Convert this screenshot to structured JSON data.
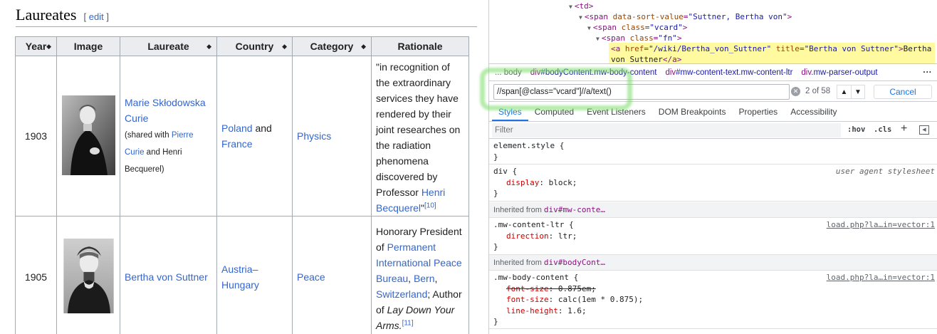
{
  "wiki": {
    "heading": "Laureates",
    "edit_link": "edit",
    "table": {
      "headers": [
        "Year",
        "Image",
        "Laureate",
        "Country",
        "Category",
        "Rationale"
      ],
      "sort_icon": "◆",
      "rows": [
        {
          "year": "1903",
          "laureate": "Marie Skłodowska Curie",
          "shared_prefix": "(shared with ",
          "shared_link1": "Pierre Curie",
          "shared_and": " and ",
          "shared_link2": "Henri Becquerel",
          "shared_suffix": ")",
          "country_a": "Poland",
          "country_and": " and ",
          "country_b": "France",
          "category": "Physics",
          "rationale_text": "\"in recognition of the extraordinary services they have rendered by their joint researches on the radiation phenomena discovered by Professor ",
          "rationale_link": "Henri Becquerel",
          "rationale_end": "\"",
          "ref": "[10]"
        },
        {
          "year": "1905",
          "laureate": "Bertha von Suttner",
          "country": "Austria–Hungary",
          "category": "Peace",
          "rationale_1": "Honorary President of ",
          "rationale_link1": "Permanent International Peace Bureau",
          "rationale_comma1": ", ",
          "rationale_link2": "Bern",
          "rationale_comma2": ", ",
          "rationale_link3": "Switzerland",
          "rationale_2": "; Author of ",
          "rationale_book": "Lay Down Your Arms.",
          "ref": "[11]"
        }
      ]
    }
  },
  "devtools": {
    "dom": {
      "line1_tag": "<td>",
      "line2_open": "<span ",
      "line2_attr": "data-sort-value",
      "line2_val": "\"Suttner, Bertha von\"",
      "line2_close": ">",
      "line3_open": "<span ",
      "line3_attr": "class",
      "line3_val": "\"vcard\"",
      "line3_close": ">",
      "line4_open": "<span ",
      "line4_attr": "class",
      "line4_val": "\"fn\"",
      "line4_close": ">",
      "line5_open": "<a ",
      "line5_attr1": "href",
      "line5_val1": "\"/wiki/Bertha_von_Suttner\"",
      "line5_attr2": "title",
      "line5_val2": "\"Bertha von Suttner\"",
      "line5_text": "Bertha",
      "line6_text": "von Suttner",
      "line6_close": "</a>"
    },
    "breadcrumbs": [
      {
        "tag": "... ",
        "cls": "",
        "extra": "body",
        "dim": true
      },
      {
        "tag": "div",
        "cls": "#bodyContent",
        "extra": ".mw-body-content"
      },
      {
        "tag": "div",
        "cls": "#mw-content-text",
        "extra": ".mw-content-ltr"
      },
      {
        "tag": "div",
        "cls": ".mw-parser-output",
        "extra": ""
      }
    ],
    "breadcrumb_more": "...",
    "search": {
      "value": "//span[@class=\"vcard\"]//a/text()",
      "count": "2 of 58",
      "cancel_label": "Cancel",
      "prev_icon": "▲",
      "next_icon": "▼",
      "clear_icon": "✕"
    },
    "tabs": [
      "Styles",
      "Computed",
      "Event Listeners",
      "DOM Breakpoints",
      "Properties",
      "Accessibility"
    ],
    "filter_placeholder": "Filter",
    "hov_label": ":hov",
    "cls_label": ".cls",
    "plus_label": "+",
    "styles": {
      "element_style": "element.style {",
      "close_brace": "}",
      "div_selector": "div {",
      "ua_source": "user agent stylesheet",
      "display_prop": "display",
      "display_val": "block;",
      "inherit1_prefix": "Inherited from ",
      "inherit1_tag": "div#mw-conte…",
      "ltr_selector": ".mw-content-ltr {",
      "ltr_source": "load.php?la…in=vector:1",
      "direction_prop": "direction",
      "direction_val": "ltr;",
      "inherit2_prefix": "Inherited from ",
      "inherit2_tag": "div#bodyCont…",
      "body_selector": ".mw-body-content {",
      "body_source": "load.php?la…in=vector:1",
      "fs1_prop": "font-size",
      "fs1_val": "0.875em;",
      "fs2_prop": "font-size",
      "fs2_val": "calc(1em * 0.875);",
      "lh_prop": "line-height",
      "lh_val": "1.6;"
    }
  }
}
